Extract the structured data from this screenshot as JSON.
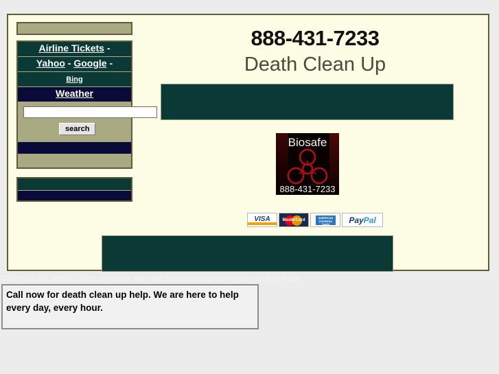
{
  "colors": {
    "page_bg": "#fdfde6",
    "outer_bg": "#ececec",
    "khaki": "#a9a982",
    "dark_green": "#0b3a36",
    "navy": "#0a0a38",
    "border_olive": "#5e5c3c",
    "tagline_text": "#4a4a3a"
  },
  "sidebar": {
    "top_panel_label": "",
    "nav_rows": [
      {
        "id": "airline-tickets",
        "label": "Airline Tickets",
        "suffix": " -",
        "style": "green",
        "size": "normal"
      },
      {
        "id": "yahoo-google",
        "label": "Yahoo",
        "label2": "Google",
        "sep": " - ",
        "suffix": " -",
        "style": "green",
        "size": "normal"
      },
      {
        "id": "bing",
        "label": "Bing",
        "suffix": "",
        "style": "green",
        "size": "small"
      },
      {
        "id": "weather",
        "label": "Weather",
        "suffix": "",
        "style": "navy",
        "size": "normal"
      }
    ],
    "search": {
      "value": "",
      "placeholder": "",
      "button_label": "search"
    }
  },
  "header": {
    "phone": "888-431-7233",
    "tagline": "Death Clean Up"
  },
  "logo": {
    "title": "Biosafe",
    "phone": "888-431-7233",
    "icon": "biohazard-icon"
  },
  "payments": [
    {
      "id": "visa",
      "label": "VISA"
    },
    {
      "id": "mastercard",
      "label": "MasterCard"
    },
    {
      "id": "amex",
      "label": "AMERICAN EXPRESS Cards"
    },
    {
      "id": "paypal",
      "label_a": "Pay",
      "label_b": "Pal"
    }
  ],
  "ghost": {
    "text": "Call now for death clean up help. We are here to help every day, every hour."
  },
  "tooltip": {
    "text": "Call now for death clean up help. We are here to help every day, every hour."
  }
}
